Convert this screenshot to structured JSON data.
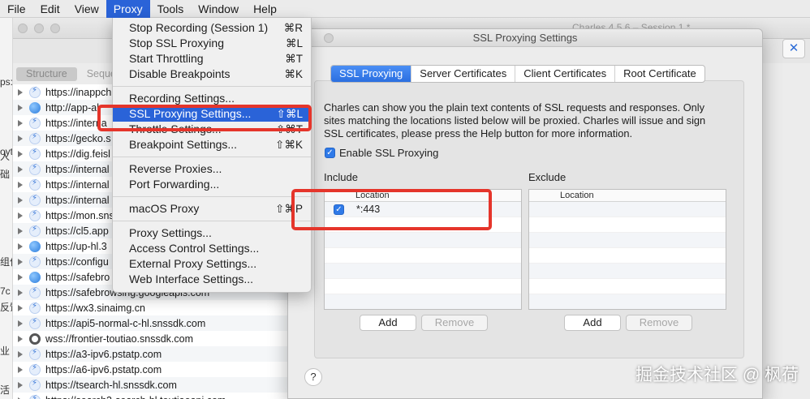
{
  "menubar": {
    "items": [
      "File",
      "Edit",
      "View",
      "Proxy",
      "Tools",
      "Window",
      "Help"
    ],
    "active": "Proxy"
  },
  "main_window": {
    "title": "Charles 4.5.6 – Session 1 *",
    "segments": [
      "Structure",
      "Sequence"
    ],
    "gutter_text": [
      "ps:/",
      "oyt",
      "人",
      "础",
      "组件",
      "7c",
      "反馈",
      "业",
      "活"
    ]
  },
  "hosts": [
    {
      "icon": "bolt",
      "text": "https://inappch"
    },
    {
      "icon": "globe",
      "text": "http://app-al"
    },
    {
      "icon": "bolt",
      "text": "https://interna"
    },
    {
      "icon": "bolt",
      "text": "https://gecko.s"
    },
    {
      "icon": "bolt",
      "text": "https://dig.feisl"
    },
    {
      "icon": "bolt",
      "text": "https://internal"
    },
    {
      "icon": "bolt",
      "text": "https://internal"
    },
    {
      "icon": "bolt",
      "text": "https://internal"
    },
    {
      "icon": "bolt",
      "text": "https://mon.sns"
    },
    {
      "icon": "bolt",
      "text": "https://cl5.app"
    },
    {
      "icon": "globe",
      "text": "https://up-hl.3"
    },
    {
      "icon": "bolt",
      "text": "https://configu"
    },
    {
      "icon": "globe",
      "text": "https://safebro"
    },
    {
      "icon": "bolt",
      "text": "https://safebrowsing.googleapis.com"
    },
    {
      "icon": "bolt",
      "text": "https://wx3.sinaimg.cn"
    },
    {
      "icon": "bolt",
      "text": "https://api5-normal-c-hl.snssdk.com"
    },
    {
      "icon": "ws",
      "text": "wss://frontier-toutiao.snssdk.com"
    },
    {
      "icon": "bolt",
      "text": "https://a3-ipv6.pstatp.com"
    },
    {
      "icon": "bolt",
      "text": "https://a6-ipv6.pstatp.com"
    },
    {
      "icon": "bolt",
      "text": "https://tsearch-hl.snssdk.com"
    },
    {
      "icon": "bolt",
      "text": "https://search3-search-hl.toutiaoapi.com"
    }
  ],
  "proxy_menu": {
    "groups": [
      [
        {
          "label": "Stop Recording (Session 1)",
          "shortcut": "⌘R"
        },
        {
          "label": "Stop SSL Proxying",
          "shortcut": "⌘L"
        },
        {
          "label": "Start Throttling",
          "shortcut": "⌘T"
        },
        {
          "label": "Disable Breakpoints",
          "shortcut": "⌘K"
        }
      ],
      [
        {
          "label": "Recording Settings...",
          "shortcut": ""
        },
        {
          "label": "SSL Proxying Settings...",
          "shortcut": "⇧⌘L",
          "highlighted": true
        },
        {
          "label": "Throttle Settings...",
          "shortcut": "⇧⌘T"
        },
        {
          "label": "Breakpoint Settings...",
          "shortcut": "⇧⌘K"
        }
      ],
      [
        {
          "label": "Reverse Proxies...",
          "shortcut": ""
        },
        {
          "label": "Port Forwarding...",
          "shortcut": ""
        }
      ],
      [
        {
          "label": "macOS Proxy",
          "shortcut": "⇧⌘P"
        }
      ],
      [
        {
          "label": "Proxy Settings...",
          "shortcut": ""
        },
        {
          "label": "Access Control Settings...",
          "shortcut": ""
        },
        {
          "label": "External Proxy Settings...",
          "shortcut": ""
        },
        {
          "label": "Web Interface Settings...",
          "shortcut": ""
        }
      ]
    ]
  },
  "ssl_dialog": {
    "title": "SSL Proxying Settings",
    "tabs": [
      "SSL Proxying",
      "Server Certificates",
      "Client Certificates",
      "Root Certificate"
    ],
    "selected_tab": "SSL Proxying",
    "description": "Charles can show you the plain text contents of SSL requests and responses. Only sites matching the locations listed below will be proxied. Charles will issue and sign SSL certificates, please press the Help button for more information.",
    "enable_label": "Enable SSL Proxying",
    "enable_checked": true,
    "include": {
      "label": "Include",
      "column": "Location",
      "rows": [
        {
          "checked": true,
          "location": "*:443"
        }
      ],
      "add_label": "Add",
      "remove_label": "Remove"
    },
    "exclude": {
      "label": "Exclude",
      "column": "Location",
      "rows": [],
      "add_label": "Add",
      "remove_label": "Remove"
    },
    "help_label": "?"
  },
  "colors": {
    "accent": "#2a63d8",
    "annotation": "#e5352b"
  },
  "watermark": "掘金技术社区 @ 枫荷"
}
